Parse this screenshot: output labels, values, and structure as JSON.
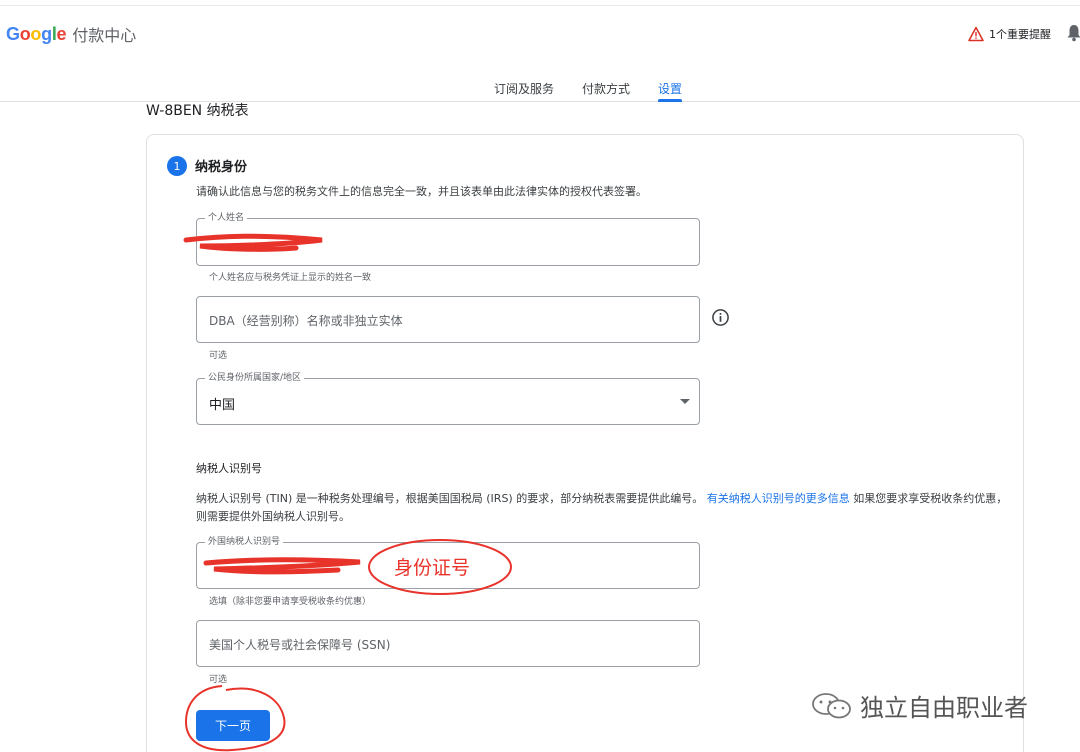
{
  "header": {
    "brand_letters": [
      "G",
      "o",
      "o",
      "g",
      "l",
      "e"
    ],
    "product": "付款中心",
    "alert_text": "1个重要提醒"
  },
  "tabs": [
    {
      "label": "订阅及服务",
      "active": false
    },
    {
      "label": "付款方式",
      "active": false
    },
    {
      "label": "设置",
      "active": true
    }
  ],
  "form": {
    "title": "W-8BEN 纳税表",
    "step": {
      "number": "1",
      "title": "纳税身份",
      "description": "请确认此信息与您的税务文件上的信息完全一致，并且该表单由此法律实体的授权代表签署。"
    },
    "fields": {
      "personal_name": {
        "label": "个人姓名",
        "helper": "个人姓名应与税务凭证上显示的姓名一致"
      },
      "dba": {
        "placeholder": "DBA（经营别称）名称或非独立实体",
        "helper": "可选"
      },
      "citizenship": {
        "label": "公民身份所属国家/地区",
        "value": "中国"
      },
      "foreign_tin": {
        "label": "外国纳税人识别号",
        "helper": "选填（除非您要申请享受税收条约优惠）"
      },
      "ssn": {
        "placeholder": "美国个人税号或社会保障号 (SSN)",
        "helper": "可选"
      }
    },
    "tin_section": {
      "title": "纳税人识别号",
      "desc_before": "纳税人识别号 (TIN) 是一种税务处理编号，根据美国国税局 (IRS) 的要求，部分纳税表需要提供此编号。",
      "link_text": "有关纳税人识别号的更多信息",
      "desc_after": " 如果您要求享受税收条约优惠，则需要提供外国纳税人识别号。"
    },
    "next_button": "下一页"
  },
  "annotation": {
    "text": "身份证号",
    "color": "#e8332b"
  },
  "watermark": {
    "text": "独立自由职业者"
  },
  "colors": {
    "accent": "#1a73e8",
    "annotation_red": "#e8332b"
  }
}
